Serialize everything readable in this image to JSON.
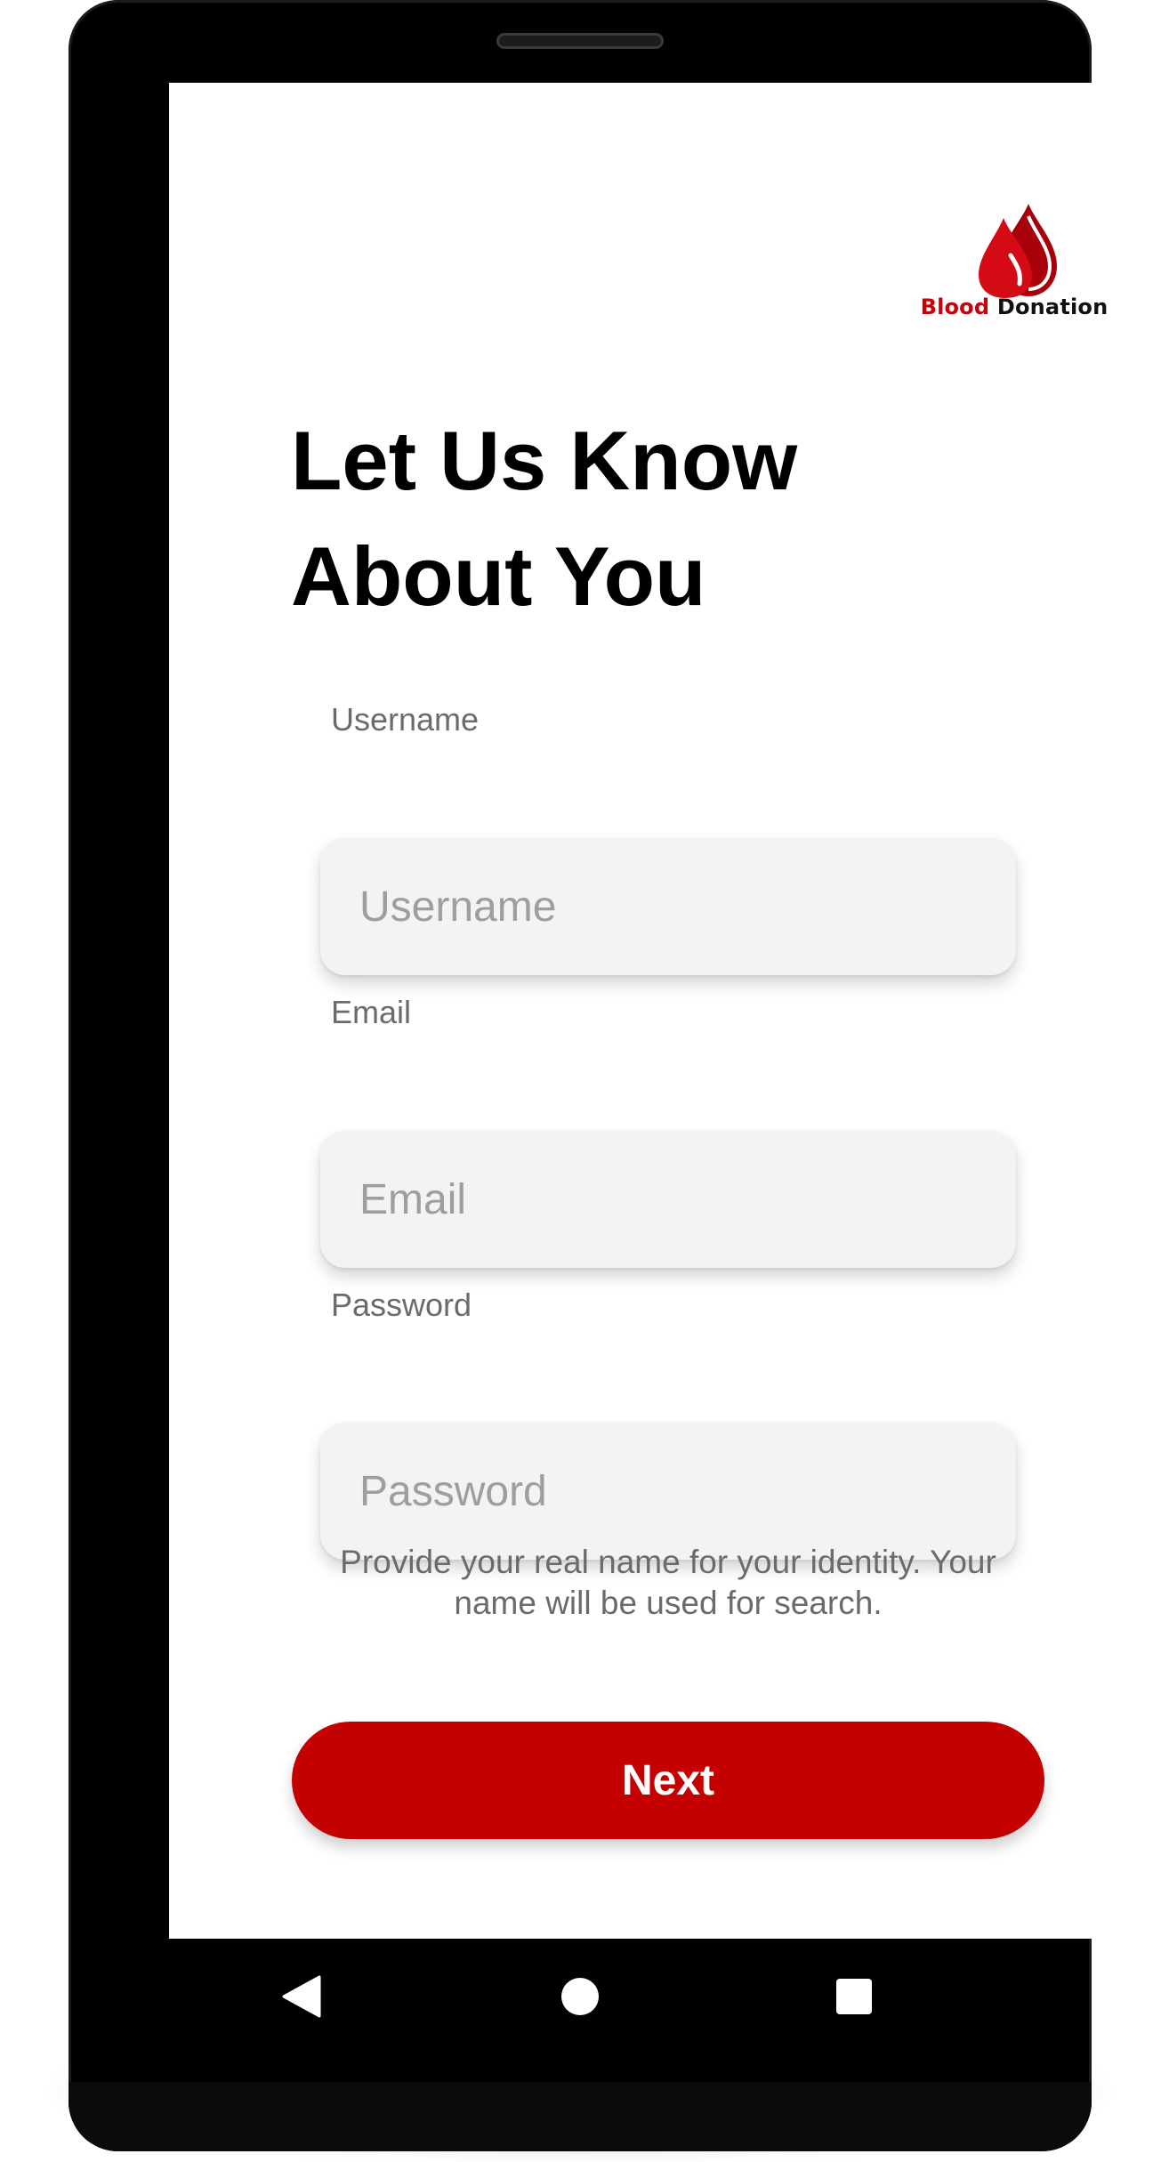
{
  "logo": {
    "text_part1": "Blood",
    "text_part2": "Donation",
    "brand_color": "#c8000a"
  },
  "page": {
    "title_line1": "Let Us Know",
    "title_line2": "About You"
  },
  "form": {
    "username": {
      "label": "Username",
      "placeholder": "Username",
      "value": ""
    },
    "email": {
      "label": "Email",
      "placeholder": "Email",
      "value": ""
    },
    "password": {
      "label": "Password",
      "placeholder": "Password",
      "value": ""
    },
    "helper_text": "Provide your real name for your identity. Your name will be used for search.",
    "next_label": "Next",
    "next_color": "#c50001"
  },
  "navbar": {
    "back_icon": "triangle-back-icon",
    "home_icon": "circle-home-icon",
    "recent_icon": "square-recents-icon"
  }
}
